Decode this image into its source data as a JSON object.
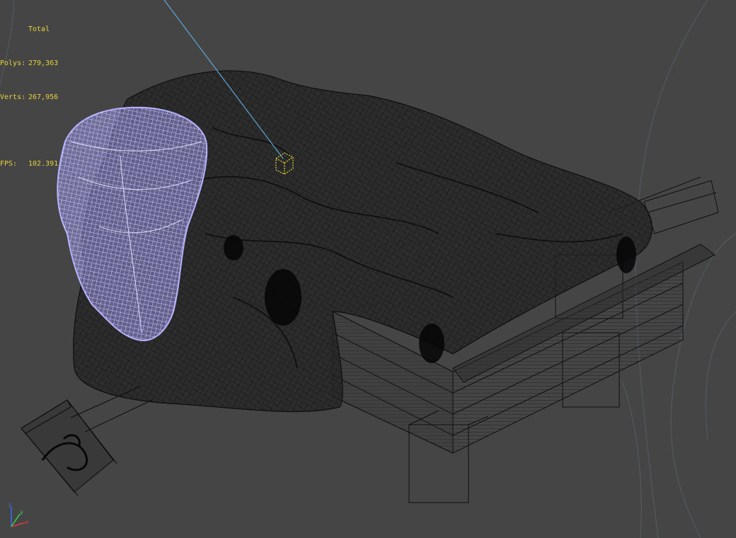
{
  "stats": {
    "header": "Total",
    "polys_label": "Polys:",
    "polys_value": "279,363",
    "verts_label": "Verts:",
    "verts_value": "267,956",
    "fps_label": "FPS:",
    "fps_value": "102.391"
  },
  "colors": {
    "background": "#454545",
    "stats_text": "#e8d23a",
    "selected_wireframe": "#b4b0ff",
    "wireframe": "#111111",
    "light_line": "#5aa6d8",
    "light_icon": "#e8d23a"
  },
  "icons": {
    "axis_gizmo": "xyz-axis-gizmo",
    "light_helper": "target-light-icon"
  }
}
